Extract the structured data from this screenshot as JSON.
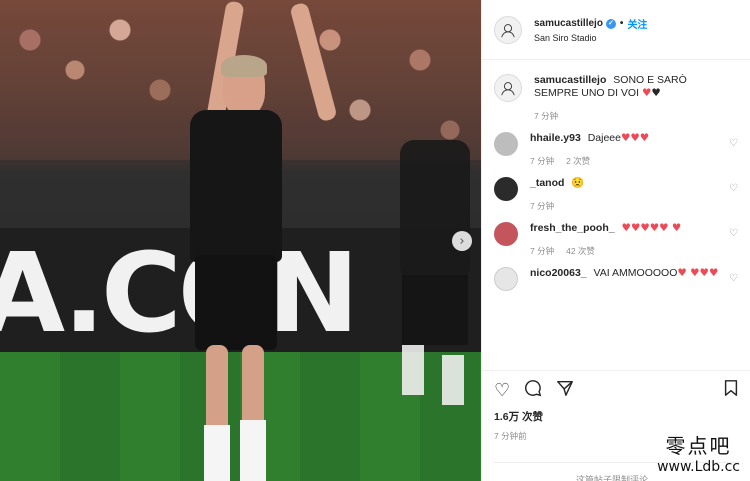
{
  "header": {
    "username": "samucastillejo",
    "follow_label": "关注",
    "location": "San Siro Stadio"
  },
  "photo": {
    "board_text": "A.CON",
    "next_icon": "chevron-right-icon"
  },
  "caption": {
    "username": "samucastillejo",
    "text": "SONO E SARÒ SEMPRE UNO DI VOI",
    "emoji": "♥",
    "emoji2": "♥",
    "time": "7 分钟"
  },
  "comments": [
    {
      "username": "hhaile.y93",
      "text": "Dajeee",
      "emoji": "♥♥♥",
      "time": "7 分钟",
      "likes": "2 次赞"
    },
    {
      "username": "_tanod",
      "text": "",
      "emoji": "😟",
      "time": "7 分钟",
      "likes": ""
    },
    {
      "username": "fresh_the_pooh_",
      "text": "",
      "emoji": "♥♥♥♥♥ ♥",
      "time": "7 分钟",
      "likes": "42 次赞"
    },
    {
      "username": "nico20063_",
      "text": "VAI AMMOOOOO",
      "emoji": "♥ ♥♥♥",
      "time": "",
      "likes": ""
    }
  ],
  "actions": {
    "likes": "1.6万 次赞",
    "time": "7 分钟前",
    "restricted": "这篇帖子限制评论。"
  },
  "watermark": {
    "cn": "零点吧",
    "url": "www.Ldb.cc"
  },
  "colors": {
    "accent": "#0095f6",
    "heart": "#ed4956"
  }
}
